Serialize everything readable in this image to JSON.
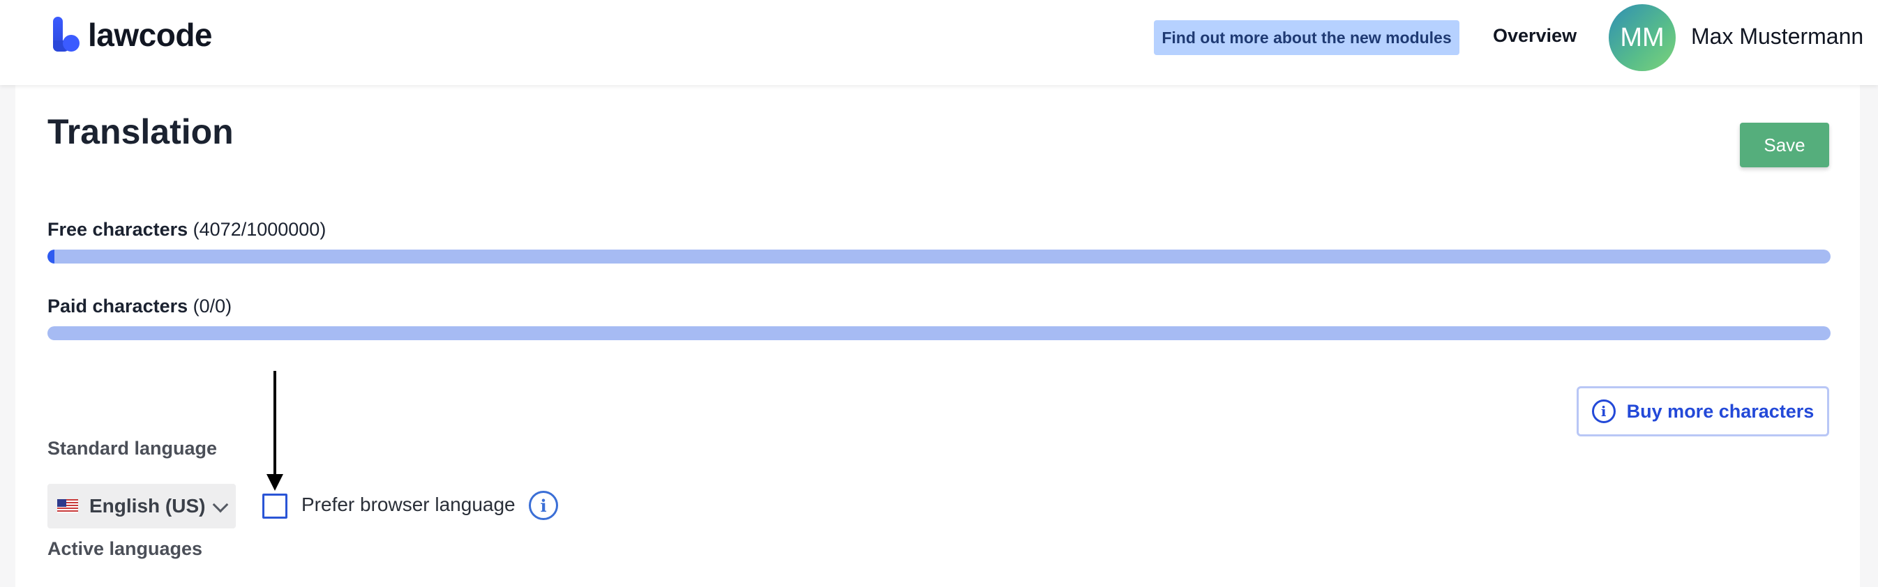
{
  "header": {
    "brand": "lawcode",
    "promo_link": "Find out more about the new modules",
    "nav_overview": "Overview",
    "user": {
      "initials": "MM",
      "name": "Max Mustermann"
    }
  },
  "page": {
    "title": "Translation",
    "save_label": "Save"
  },
  "quotas": {
    "free": {
      "label": "Free characters",
      "count_text": "(4072/1000000)",
      "used": 4072,
      "total": 1000000
    },
    "paid": {
      "label": "Paid characters",
      "count_text": "(0/0)",
      "used": 0,
      "total": 0
    }
  },
  "buy_more": {
    "label": "Buy more characters",
    "icon": "info-icon"
  },
  "standard_language": {
    "label": "Standard language",
    "selected": "English (US)",
    "flag_icon": "us-flag-icon",
    "prefer_browser": {
      "label": "Prefer browser language",
      "checked": false
    }
  },
  "active_languages": {
    "label": "Active languages"
  },
  "colors": {
    "brand_blue": "#2e5bf0",
    "save_green": "#55ae7c",
    "progress_track": "#a6bbf3",
    "promo_bg": "#b6d1ff"
  }
}
